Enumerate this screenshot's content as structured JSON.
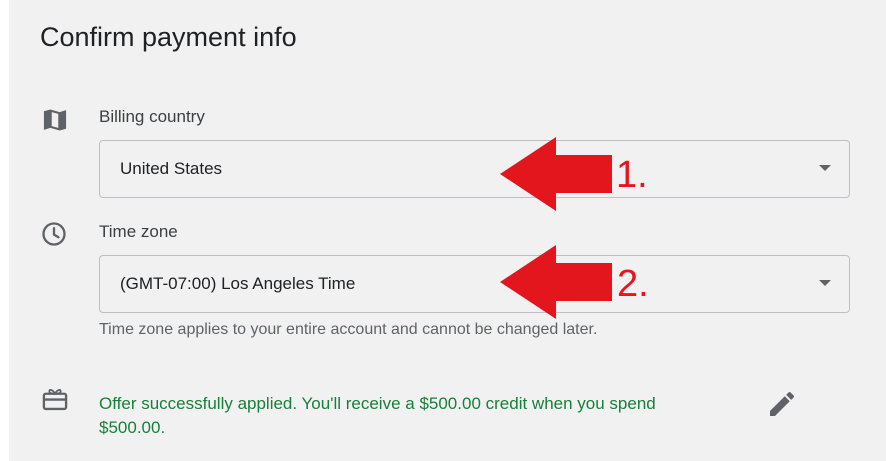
{
  "title": "Confirm payment info",
  "billing": {
    "label": "Billing country",
    "value": "United States",
    "icon": "map-icon"
  },
  "timezone": {
    "label": "Time zone",
    "value": "(GMT-07:00) Los Angeles Time",
    "helper": "Time zone applies to your entire account and cannot be changed later.",
    "icon": "clock-icon"
  },
  "offer": {
    "text": "Offer successfully applied. You'll receive a $500.00 credit when you spend $500.00.",
    "icon": "gift-card-icon",
    "edit_icon": "pencil-icon"
  },
  "annotations": {
    "first": "1.",
    "second": "2.",
    "color": "#e3161e"
  },
  "colors": {
    "background": "#f1f1f1",
    "success_text": "#188038",
    "secondary_text": "#5f6368"
  }
}
